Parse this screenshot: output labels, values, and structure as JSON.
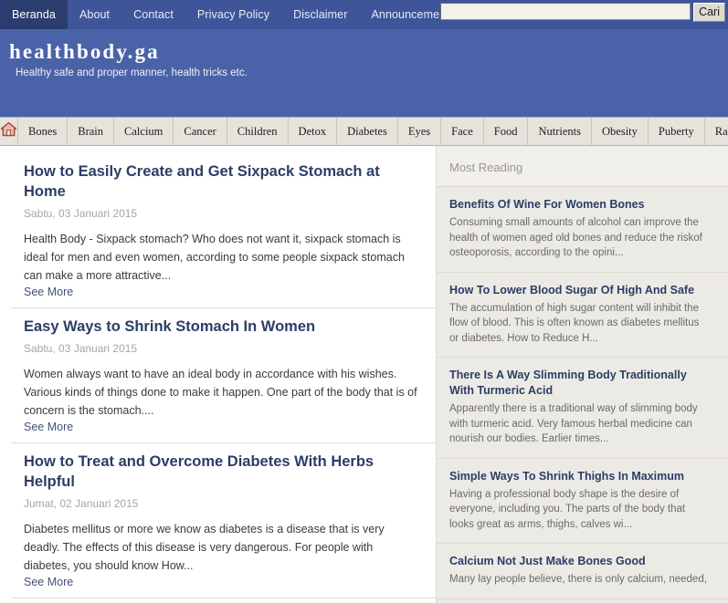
{
  "topnav": {
    "items": [
      {
        "label": "Beranda",
        "active": true
      },
      {
        "label": "About",
        "active": false
      },
      {
        "label": "Contact",
        "active": false
      },
      {
        "label": "Privacy Policy",
        "active": false
      },
      {
        "label": "Disclaimer",
        "active": false
      },
      {
        "label": "Announcement",
        "active": false
      }
    ],
    "search": {
      "value": "",
      "placeholder": "",
      "button_label": "Cari"
    }
  },
  "banner": {
    "title": "healthbody.ga",
    "tagline": "Healthy safe and proper manner, health tricks etc."
  },
  "categories": {
    "home_icon": "home-icon",
    "items": [
      {
        "label": "Bones"
      },
      {
        "label": "Brain"
      },
      {
        "label": "Calcium"
      },
      {
        "label": "Cancer"
      },
      {
        "label": "Children"
      },
      {
        "label": "Detox"
      },
      {
        "label": "Diabetes"
      },
      {
        "label": "Eyes"
      },
      {
        "label": "Face"
      },
      {
        "label": "Food"
      },
      {
        "label": "Nutrients"
      },
      {
        "label": "Obesity"
      },
      {
        "label": "Puberty"
      },
      {
        "label": "Raise Body"
      }
    ]
  },
  "main": {
    "posts": [
      {
        "title": "How to Easily Create and Get Sixpack Stomach at Home",
        "date": "Sabtu, 03 Januari 2015",
        "excerpt": "Health Body - Sixpack stomach? Who does not want it, sixpack stomach is ideal for men and even women, according to some people sixpack stomach can make a more attractive...",
        "more_label": "See More"
      },
      {
        "title": "Easy Ways to Shrink Stomach In Women",
        "date": "Sabtu, 03 Januari 2015",
        "excerpt": "Women always want to have an ideal body in accordance with his wishes. Various kinds of things done to make it happen. One part of the body that is of concern is the stomach....",
        "more_label": "See More"
      },
      {
        "title": "How to Treat and Overcome Diabetes With Herbs Helpful",
        "date": "Jumat, 02 Januari 2015",
        "excerpt": "Diabetes mellitus or more we know as diabetes is a disease that is very deadly. The effects of this disease is very dangerous. For people with diabetes, you should know How...",
        "more_label": "See More"
      }
    ]
  },
  "sidebar": {
    "widget_title": "Most Reading",
    "items": [
      {
        "title": "Benefits Of Wine For Women Bones",
        "snippet": "Consuming small amounts of alcohol can improve the health of women aged old bones and reduce the riskof osteoporosis, according to the opini..."
      },
      {
        "title": "How To Lower Blood Sugar Of High And Safe",
        "snippet": "The accumulation of high sugar content will inhibit the flow of blood. This is often known as diabetes mellitus or diabetes. How to Reduce H..."
      },
      {
        "title": "There Is A Way Slimming Body Traditionally With Turmeric Acid",
        "snippet": "Apparently there is a traditional way of slimming body with turmeric acid. Very famous herbal medicine can nourish our bodies. Earlier times..."
      },
      {
        "title": "Simple Ways To Shrink Thighs In Maximum",
        "snippet": "Having a professional body shape is the desire of everyone, including you. The parts of the body that looks great as arms, thighs, calves wi..."
      },
      {
        "title": "Calcium Not Just Make Bones Good",
        "snippet": "Many lay people believe, there is only calcium, needed,"
      }
    ]
  },
  "colors": {
    "topbar_blue": "#3e5699",
    "active_tab_blue": "#2b3c6e",
    "banner_blue": "#4a63a8",
    "category_bar": "#e6e3dc",
    "sidebar_bg": "#eceae4",
    "link_navy": "#2c3d66",
    "home_icon_red": "#b04a3e"
  }
}
